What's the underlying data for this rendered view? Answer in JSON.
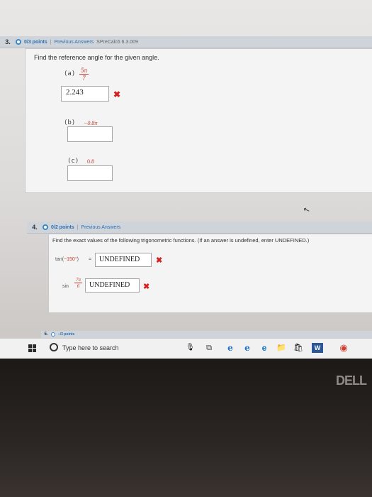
{
  "q3": {
    "number": "3.",
    "points": "0/3 points",
    "sep": "|",
    "prev_answers": "Previous Answers",
    "source": "SPreCalc6 6.3.009",
    "prompt": "Find the reference angle for the given angle.",
    "a": {
      "label": "(a)",
      "num": "5π",
      "den": "7",
      "answer": "2.243",
      "status": "incorrect"
    },
    "b": {
      "label": "(b)",
      "given": "−0.8π",
      "answer": ""
    },
    "c": {
      "label": "(c)",
      "given": "0.8",
      "answer": ""
    }
  },
  "q4": {
    "number": "4.",
    "points": "0/2 points",
    "sep": "|",
    "prev_answers": "Previous Answers",
    "prompt": "Find the exact values of the following trigonometric functions. (If an answer is undefined, enter UNDEFINED.)",
    "tan": {
      "func": "tan(",
      "angle": "−150°",
      "close": ")",
      "eq": "=",
      "answer": "UNDEFINED",
      "status": "incorrect"
    },
    "sin": {
      "func": "sin",
      "num": "7π",
      "den": "6",
      "eq": "=",
      "answer": "UNDEFINED",
      "status": "incorrect"
    }
  },
  "q5": {
    "number": "5.",
    "points": "–/3 points"
  },
  "taskbar": {
    "search_placeholder": "Type here to search"
  },
  "icons": {
    "x_mark": "✖",
    "mic": "🎙",
    "task_view": "⧉",
    "edge": "e",
    "folder": "📁",
    "store": "🛍",
    "word": "W",
    "chrome": "◉"
  },
  "brand": {
    "logo": "DELL"
  },
  "colors": {
    "accent_blue": "#2d6fb0",
    "error_red": "#d62020",
    "given_red": "#c0392b"
  }
}
